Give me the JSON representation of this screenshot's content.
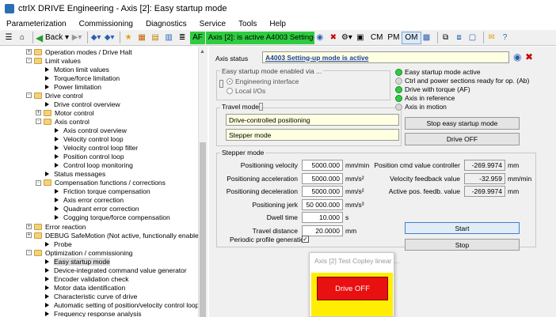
{
  "window": {
    "title": "ctrlX DRIVE Engineering - Axis [2]: Easy startup mode"
  },
  "menu": [
    "Parameterization",
    "Commissioning",
    "Diagnostics",
    "Service",
    "Tools",
    "Help"
  ],
  "toolbar": {
    "back": "Back",
    "af": "AF",
    "axis_status": "Axis [2]:  is active  A4003 Setting-u",
    "cm": "CM",
    "pm": "PM",
    "om": "OM"
  },
  "tree": [
    {
      "label": "Operation modes / Drive Halt",
      "t": "folder",
      "exp": "+"
    },
    {
      "label": "Limit values",
      "t": "folder",
      "exp": "-"
    },
    {
      "label": "Motion limit values",
      "t": "leaf"
    },
    {
      "label": "Torque/force limitation",
      "t": "leaf"
    },
    {
      "label": "Power limitation",
      "t": "leaf"
    },
    {
      "label": "Drive control",
      "t": "folder",
      "exp": "-"
    },
    {
      "label": "Drive control overview",
      "t": "leaf"
    },
    {
      "label": "Motor control",
      "t": "folder",
      "exp": "+"
    },
    {
      "label": "Axis control",
      "t": "folder",
      "exp": "-"
    },
    {
      "label": "Axis control overview",
      "t": "leaf"
    },
    {
      "label": "Velocity control loop",
      "t": "leaf"
    },
    {
      "label": "Velocity control loop filter",
      "t": "leaf"
    },
    {
      "label": "Position control loop",
      "t": "leaf"
    },
    {
      "label": "Control loop monitoring",
      "t": "leaf"
    },
    {
      "label": "Status messages",
      "t": "leaf"
    },
    {
      "label": "Compensation functions / corrections",
      "t": "folder",
      "exp": "-"
    },
    {
      "label": "Friction torque compensation",
      "t": "leaf"
    },
    {
      "label": "Axis error correction",
      "t": "leaf"
    },
    {
      "label": "Quadrant error correction",
      "t": "leaf"
    },
    {
      "label": "Cogging torque/force compensation",
      "t": "leaf"
    },
    {
      "label": "Error reaction",
      "t": "folder",
      "exp": "+"
    },
    {
      "label": "DEBUG SafeMotion (Not active, functionally enabled): def",
      "t": "folder",
      "exp": "+"
    },
    {
      "label": "Probe",
      "t": "leaf"
    },
    {
      "label": "Optimization / commissioning",
      "t": "folder",
      "exp": "-"
    },
    {
      "label": "Easy startup mode",
      "t": "leaf"
    },
    {
      "label": "Device-integrated command value generator",
      "t": "leaf"
    },
    {
      "label": "Encoder validation check",
      "t": "leaf"
    },
    {
      "label": "Motor data identification",
      "t": "leaf"
    },
    {
      "label": "Characteristic curve of drive",
      "t": "leaf"
    },
    {
      "label": "Automatic setting of position/velocity control loop...",
      "t": "leaf"
    },
    {
      "label": "Frequency response analysis",
      "t": "leaf"
    }
  ],
  "panel": {
    "axis_status_label": "Axis status",
    "axis_status_value": "A4003 Setting-up mode is active",
    "enabled_via": {
      "title": "Easy startup mode enabled via ...",
      "options": [
        "Engineering interface",
        "Local I/Os"
      ]
    },
    "travel_mode": {
      "title": "Travel mode",
      "values": [
        "Drive-controlled positioning",
        "Stepper mode"
      ]
    },
    "indicators": [
      {
        "label": "Easy startup mode active",
        "color": "#2ecc40"
      },
      {
        "label": "Ctrl and power sections ready for op. (Ab)",
        "color": "#d8d8d8"
      },
      {
        "label": "Drive with torque (AF)",
        "color": "#2ecc40"
      },
      {
        "label": "Axis in reference",
        "color": "#2ecc40"
      },
      {
        "label": "Axis in motion",
        "color": "#d8d8d8"
      }
    ],
    "stop_easy": "Stop easy startup mode",
    "drive_off": "Drive OFF",
    "stepper": {
      "title": "Stepper mode",
      "params": [
        {
          "label": "Positioning velocity",
          "value": "5000.000",
          "unit": "mm/min"
        },
        {
          "label": "Positioning acceleration",
          "value": "5000.000",
          "unit": "mm/s²"
        },
        {
          "label": "Positioning deceleration",
          "value": "5000.000",
          "unit": "mm/s²"
        },
        {
          "label": "Positioning jerk",
          "value": "50 000.000",
          "unit": "mm/s³"
        },
        {
          "label": "Dwell time",
          "value": "10.000",
          "unit": "s"
        },
        {
          "label": "Travel distance",
          "value": "20.0000",
          "unit": "mm"
        }
      ],
      "periodic": "Periodic profile generation",
      "readouts": [
        {
          "label": "Position cmd value controller",
          "value": "-269.9974",
          "unit": "mm"
        },
        {
          "label": "Velocity feedback value",
          "value": "-32.959",
          "unit": "mm/min"
        },
        {
          "label": "Active pos. feedb. value",
          "value": "-269.9974",
          "unit": "mm"
        }
      ],
      "start": "Start",
      "stop": "Stop"
    }
  },
  "popup": {
    "title": "Axis [2] Test Copley linear ...",
    "button": "Drive OFF"
  }
}
